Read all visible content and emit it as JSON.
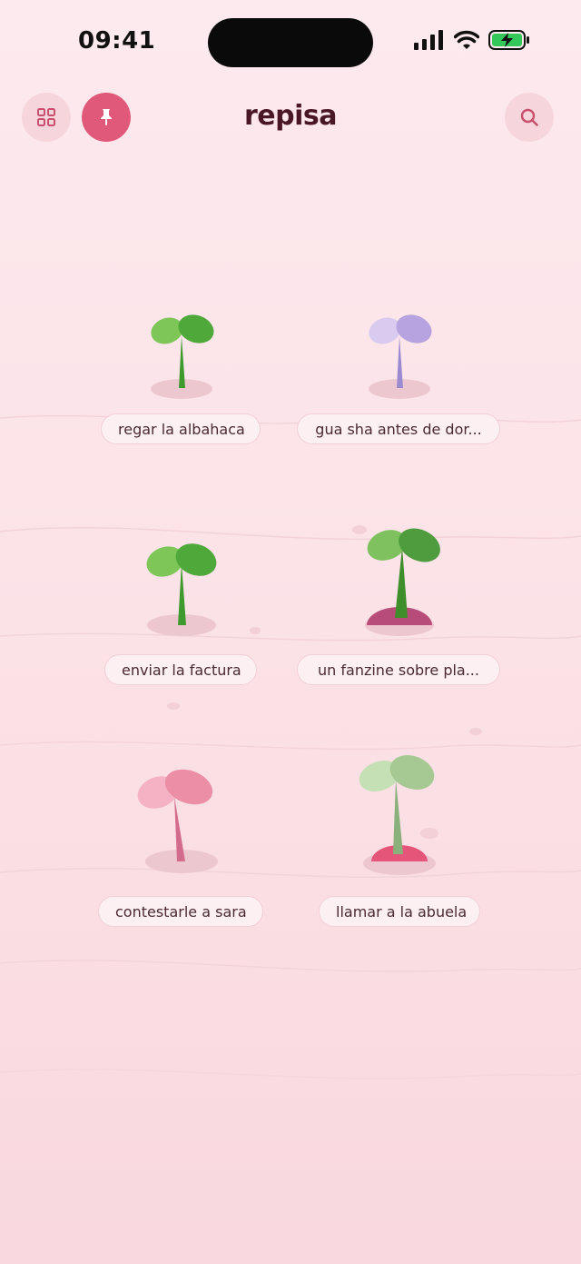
{
  "status_bar": {
    "time": "09:41",
    "battery_color": "#34c759"
  },
  "header": {
    "title": "repisa",
    "grid_button_icon": "grid-icon",
    "pin_button_icon": "pin-icon",
    "search_button_icon": "search-icon",
    "accent_color": "#e0587a"
  },
  "shelf": {
    "plants": [
      {
        "label": "regar la albahaca",
        "icon": "sprout-icon",
        "color": "green"
      },
      {
        "label": "gua sha antes de dor...",
        "icon": "sprout-icon",
        "color": "lavender"
      },
      {
        "label": "enviar la factura",
        "icon": "sprout-icon",
        "color": "green"
      },
      {
        "label": "un fanzine sobre pla...",
        "icon": "sprout-icon",
        "color": "green-with-pot"
      },
      {
        "label": "contestarle a sara",
        "icon": "sprout-icon",
        "color": "pink"
      },
      {
        "label": "llamar a la abuela",
        "icon": "sprout-icon",
        "color": "sage-with-pot"
      }
    ]
  }
}
